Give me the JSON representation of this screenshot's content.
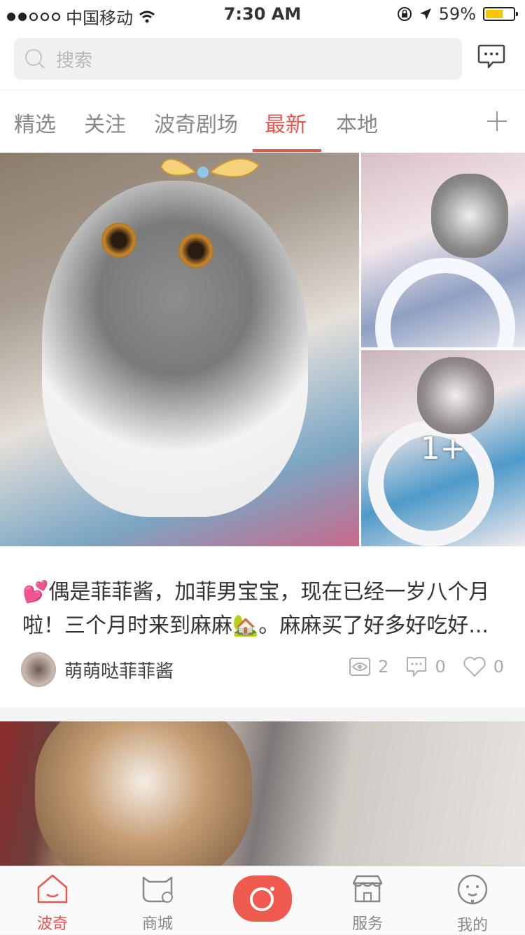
{
  "status_bar": {
    "carrier": "中国移动",
    "time": "7:30 AM",
    "battery": "59%",
    "battery_level": 0.59
  },
  "search": {
    "placeholder": "搜索"
  },
  "tabs": [
    {
      "label": "精选"
    },
    {
      "label": "关注"
    },
    {
      "label": "波奇剧场"
    },
    {
      "label": "最新"
    },
    {
      "label": "本地"
    }
  ],
  "active_tab": "最新",
  "post": {
    "more_images_label": "1+",
    "text_line1": "💕偶是菲菲酱，加菲男宝宝，现在已经一岁八个月",
    "text_line2": "啦！三个月时来到麻麻🏡。麻麻买了好多好吃好...",
    "author": "萌萌哒菲菲酱",
    "views": "2",
    "comments": "0",
    "likes": "0"
  },
  "tabbar": [
    {
      "label": "波奇",
      "icon": "home-icon"
    },
    {
      "label": "商城",
      "icon": "shop-cat-icon"
    },
    {
      "label": "",
      "icon": "camera-icon"
    },
    {
      "label": "服务",
      "icon": "store-icon"
    },
    {
      "label": "我的",
      "icon": "profile-icon"
    }
  ],
  "colors": {
    "accent": "#e8554e",
    "tab_inactive": "#888888",
    "camera_button": "#ee5a4e"
  }
}
